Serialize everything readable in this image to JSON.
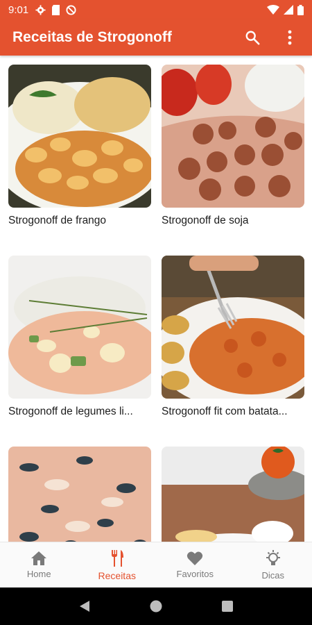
{
  "status_bar": {
    "time": "9:01"
  },
  "app_bar": {
    "title": "Receitas de Strogonoff",
    "search_icon": "search-icon",
    "menu_icon": "more-vert-icon"
  },
  "recipes": [
    {
      "title": "Strogonoff de frango"
    },
    {
      "title": "Strogonoff de soja"
    },
    {
      "title": "Strogonoff de legumes li..."
    },
    {
      "title": "Strogonoff fit com batata..."
    },
    {
      "title": ""
    },
    {
      "title": ""
    }
  ],
  "bottom_nav": {
    "items": [
      {
        "label": "Home",
        "icon": "home-icon"
      },
      {
        "label": "Receitas",
        "icon": "fork-knife-icon"
      },
      {
        "label": "Favoritos",
        "icon": "heart-icon"
      },
      {
        "label": "Dicas",
        "icon": "lightbulb-icon"
      }
    ],
    "active_index": 1
  },
  "colors": {
    "primary": "#E4522F",
    "inactive": "#7a7a7a",
    "background": "#ffffff"
  }
}
